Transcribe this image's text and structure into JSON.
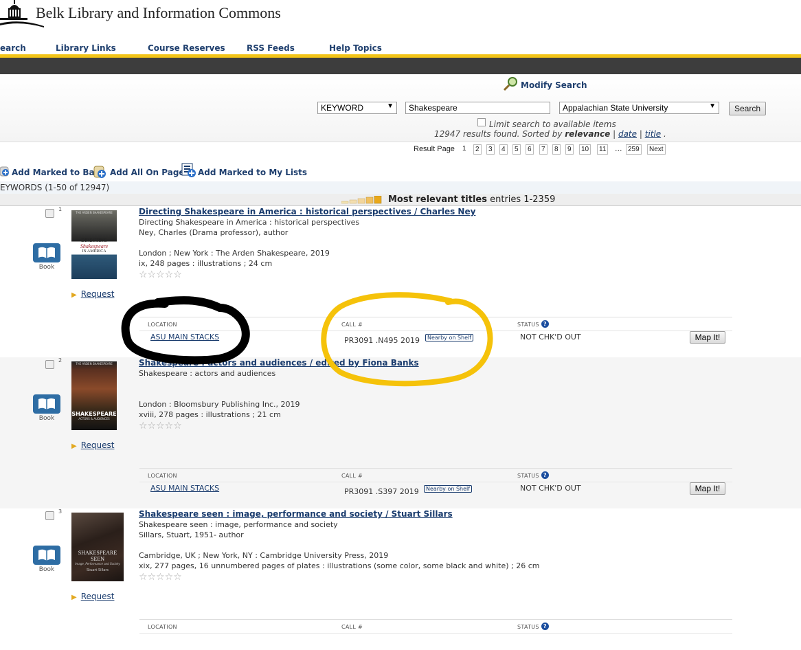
{
  "brand": {
    "title": "Belk Library and Information Commons"
  },
  "nav": [
    "earch",
    "Library Links",
    "Course Reserves",
    "RSS Feeds",
    "Help Topics"
  ],
  "search": {
    "modify_label": "Modify Search",
    "index_value": "KEYWORD",
    "query_value": "Shakespeare",
    "scope_value": "Appalachian State University",
    "button_label": "Search",
    "limit_label": "Limit search to available items",
    "summary_prefix": "12947 results found. Sorted by ",
    "summary_sort": "relevance",
    "summary_sep": " | ",
    "sort_date": "date",
    "sort_title": "title",
    "summary_end": " ."
  },
  "pager": {
    "label": "Result Page",
    "pages": [
      "1",
      "2",
      "3",
      "4",
      "5",
      "6",
      "7",
      "8",
      "9",
      "10",
      "11"
    ],
    "ellipsis": "...",
    "last": "259",
    "next": "Next"
  },
  "bag": {
    "add_marked": "Add Marked to Bag",
    "add_all": "Add All On Page",
    "add_lists": "Add Marked to My Lists"
  },
  "keywords_label": "EYWORDS (1-50 of 12947)",
  "relevance": {
    "bold": "Most relevant titles",
    "entries": " entries 1-2359"
  },
  "labels": {
    "book": "Book",
    "request": "Request",
    "location_head": "LOCATION",
    "call_head": "CALL #",
    "status_head": "STATUS",
    "nearby": "Nearby on Shelf",
    "map": "Map It!",
    "stars": "☆☆☆☆☆"
  },
  "records": [
    {
      "num": "1",
      "title": "Directing Shakespeare in America : historical perspectives / Charles Ney",
      "subtitle": "Directing Shakespeare in America : historical perspectives",
      "author": "Ney, Charles (Drama professor), author",
      "publisher": "London ; New York : The Arden Shakespeare, 2019",
      "extent": "ix, 248 pages : illustrations ; 24 cm",
      "location": "ASU MAIN STACKS",
      "call": "PR3091 .N495 2019",
      "status": "NOT CHK'D OUT",
      "cover_lines": [
        "THE ARDEN SHAKESPEARE",
        "DIRECTING",
        "Shakespeare",
        "IN AMERICA"
      ]
    },
    {
      "num": "2",
      "title": "Shakespeare : actors and audiences / edited by Fiona Banks",
      "subtitle": "Shakespeare : actors and audiences",
      "author": "",
      "publisher": "London : Bloomsbury Publishing Inc., 2019",
      "extent": "xviii, 278 pages : illustrations ; 21 cm",
      "location": "ASU MAIN STACKS",
      "call": "PR3091 .S397 2019",
      "status": "NOT CHK'D OUT",
      "cover_lines": [
        "THE ARDEN SHAKESPEARE",
        "SHAKESPEARE",
        "ACTORS & AUDIENCES"
      ]
    },
    {
      "num": "3",
      "title": "Shakespeare seen : image, performance and society / Stuart Sillars",
      "subtitle": "Shakespeare seen : image, performance and society",
      "author": "Sillars, Stuart, 1951- author",
      "publisher": "Cambridge, UK ; New York, NY : Cambridge University Press, 2019",
      "extent": "xix, 277 pages, 16 unnumbered pages of plates : illustrations (some color, some black and white) ; 26 cm",
      "location": "",
      "call": "",
      "status": "",
      "cover_lines": [
        "SHAKESPEARE",
        "SEEN",
        "Image, Performance and Society",
        "Stuart Sillars"
      ]
    }
  ]
}
